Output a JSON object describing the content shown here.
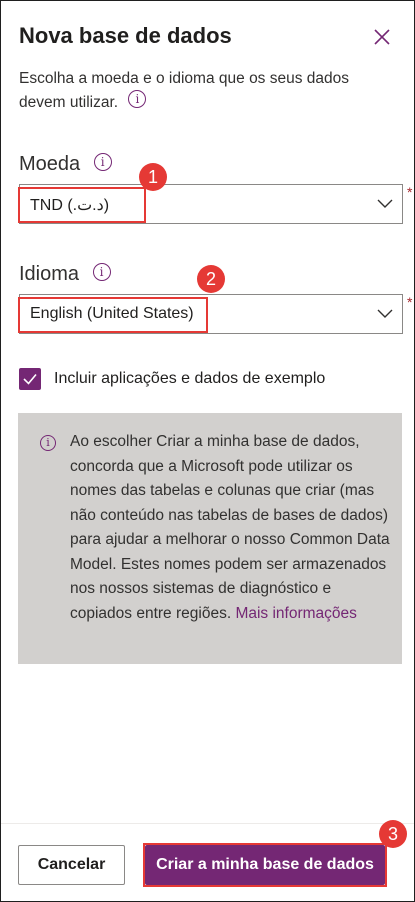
{
  "dialog": {
    "title": "Nova base de dados",
    "description_line1": "Escolha a moeda e o idioma que os seus dados",
    "description_line2": "devem utilizar."
  },
  "currency": {
    "label": "Moeda",
    "value": "TND (.د.ت)",
    "required_mark": "*"
  },
  "language": {
    "label": "Idioma",
    "value": "English (United States)",
    "required_mark": "*"
  },
  "sample_data": {
    "label": "Incluir aplicações e dados de exemplo",
    "checked": true
  },
  "notice": {
    "text": "Ao escolher Criar a minha base de dados, concorda que a Microsoft pode utilizar os nomes das tabelas e colunas que criar (mas não conteúdo nas tabelas de bases de dados) para ajudar a melhorar o nosso Common Data Model. Estes nomes podem ser armazenados nos nossos sistemas de diagnóstico e copiados entre regiões.",
    "link": "Mais informações"
  },
  "buttons": {
    "cancel": "Cancelar",
    "create": "Criar a minha base de dados"
  },
  "annotations": [
    "1",
    "2",
    "3"
  ],
  "info_glyph": "i",
  "icons": {
    "close": "close-icon",
    "info": "info-icon",
    "chevron": "chevron-down-icon",
    "check": "checkmark-icon"
  },
  "colors": {
    "accent": "#742774",
    "highlight": "#e53935",
    "notice_bg": "#d2d0ce",
    "required": "#a4262c"
  }
}
